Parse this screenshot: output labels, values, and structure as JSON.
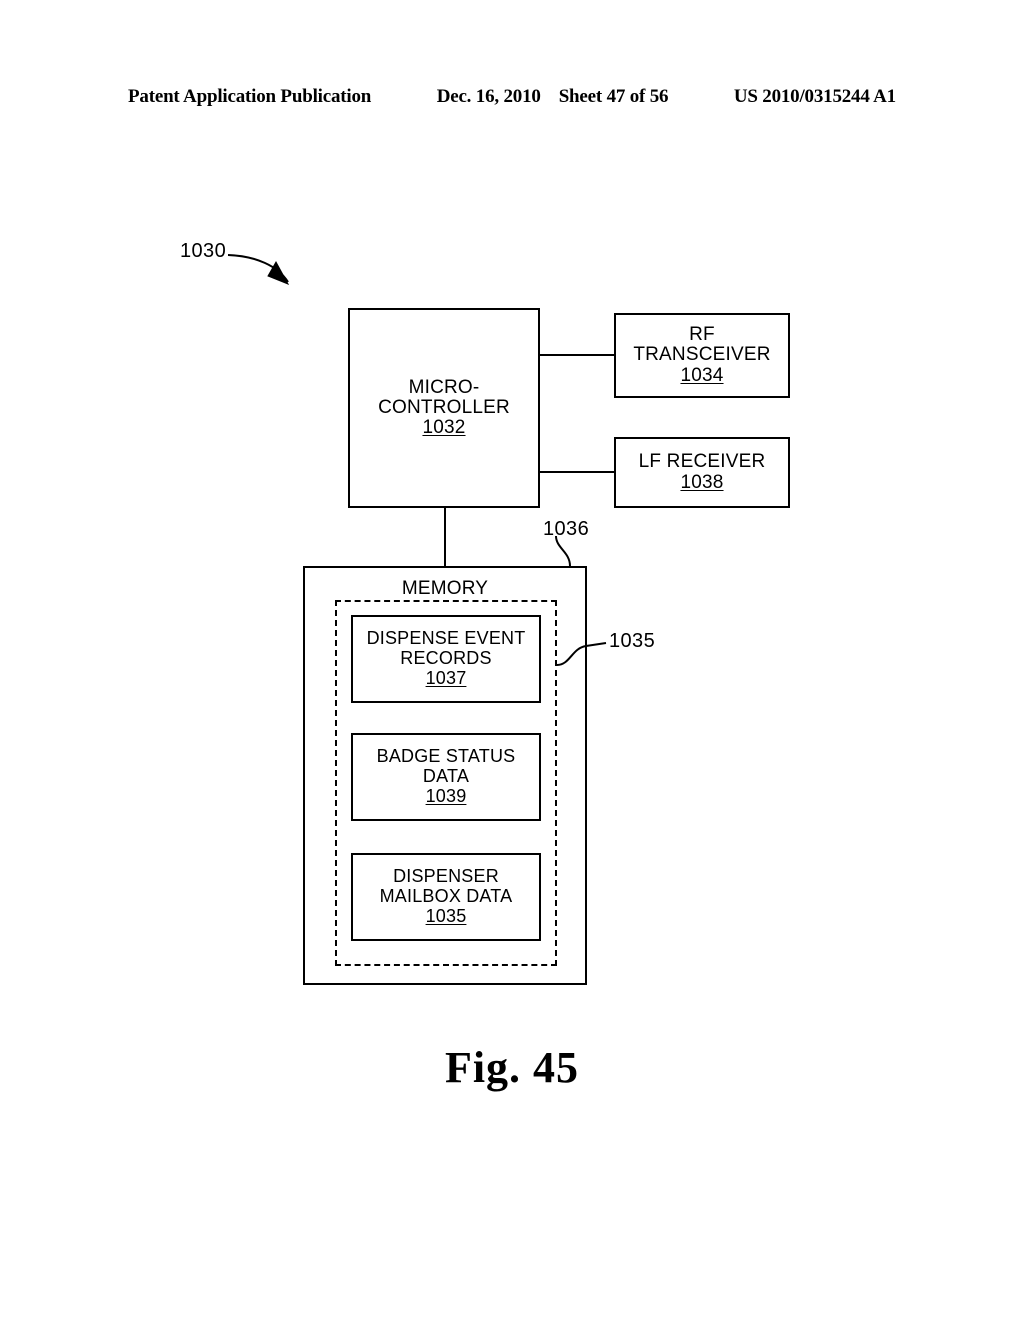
{
  "header": {
    "publication": "Patent Application Publication",
    "date": "Dec. 16, 2010",
    "sheet": "Sheet 47 of 56",
    "patent_number": "US 2010/0315244 A1"
  },
  "figure": {
    "caption": "Fig. 45",
    "system_ref": "1030"
  },
  "blocks": {
    "microcontroller": {
      "line1": "MICRO-",
      "line2": "CONTROLLER",
      "ref": "1032"
    },
    "rf_transceiver": {
      "line1": "RF",
      "line2": "TRANSCEIVER",
      "ref": "1034"
    },
    "lf_receiver": {
      "line1": "LF RECEIVER",
      "ref": "1038"
    },
    "memory": {
      "label": "MEMORY",
      "ref": "1036",
      "inner_group_ref": "1035",
      "items": [
        {
          "line1": "DISPENSE EVENT",
          "line2": "RECORDS",
          "ref": "1037"
        },
        {
          "line1": "BADGE STATUS",
          "line2": "DATA",
          "ref": "1039"
        },
        {
          "line1": "DISPENSER",
          "line2": "MAILBOX DATA",
          "ref": "1035"
        }
      ]
    }
  }
}
